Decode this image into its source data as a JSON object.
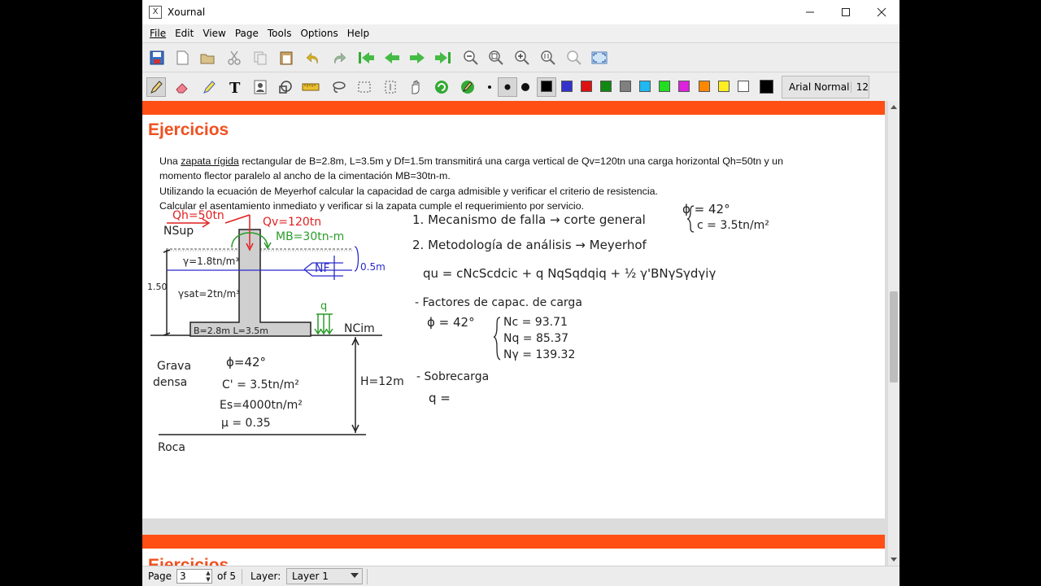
{
  "window": {
    "title": "Xournal",
    "app_icon_glyph": "X"
  },
  "menu": [
    "File",
    "Edit",
    "View",
    "Page",
    "Tools",
    "Options",
    "Help"
  ],
  "toolbar1": [
    "save-icon",
    "new-page-icon",
    "open-icon",
    "cut-icon",
    "copy-icon",
    "paste-icon",
    "undo-icon",
    "redo-icon",
    "first-page-icon",
    "previous-page-icon",
    "next-page-icon",
    "last-page-icon",
    "zoom-out-icon",
    "zoom-fit-icon",
    "zoom-in-icon",
    "zoom-100-icon",
    "zoom-width-icon",
    "fullscreen-icon"
  ],
  "toolbar2": {
    "tools": [
      "pen-icon",
      "eraser-icon",
      "highlighter-icon",
      "text-icon",
      "image-icon",
      "shape-recognizer-icon",
      "ruler-icon",
      "lasso-select-icon",
      "rect-select-icon",
      "vertical-space-icon",
      "hand-icon",
      "default-tool-icon",
      "default-pen-icon"
    ],
    "active_tool": "pen-icon",
    "thickness": [
      "fine",
      "medium",
      "thick"
    ],
    "active_thickness": "medium",
    "colors": [
      "#000000",
      "#3333cc",
      "#dd1111",
      "#118811",
      "#808080",
      "#1fb8f0",
      "#22dd22",
      "#dd22dd",
      "#ff8800",
      "#ffee22",
      "#ffffff",
      "#000000"
    ],
    "active_color_index": 0,
    "font_name": "Arial Normal",
    "font_size": "12"
  },
  "page_content": {
    "title": "Ejercicios",
    "paragraph": {
      "p1": "Una",
      "p1_underlined": "zapata rígida",
      "p1_rest": "rectangular de B=2.8m, L=3.5m y Df=1.5m transmitirá una carga vertical de Qv=120tn una carga horizontal Qh=50tn y un",
      "p2": "momento flector paralelo al ancho de la cimentación MB=30tn-m.",
      "p3": "Utilizando la ecuación de Meyerhof calcular la capacidad de carga admisible y verificar el criterio de resistencia.",
      "p4": "Calcular el asentamiento inmediato y verificar si la zapata cumple el requerimiento por servicio."
    },
    "next_page_title": "Ejercicios"
  },
  "handwriting": {
    "qh": "Qh=50tn",
    "qv": "Qv=120tn",
    "mb": "MB=30tn-m",
    "nsup": "NSup",
    "gamma": "γ=1.8tn/m³",
    "gamma_sat": "γsat=2tn/m³",
    "depth": "1.50",
    "nf": "NF",
    "nf_depth": "0.5m",
    "q": "q",
    "ncim": "NCim",
    "b_l": "B=2.8m  L=3.5m",
    "grava": "Grava",
    "densa": "densa",
    "phi": "ϕ=42°",
    "c": "C' = 3.5tn/m²",
    "es": "Es=4000tn/m²",
    "mu": "μ = 0.35",
    "h": "H=12m",
    "roca": "Roca",
    "item1": "1. Mecanismo de falla → corte general",
    "phi_c_1": "ϕ = 42°",
    "phi_c_2": "c = 3.5tn/m²",
    "item2": "2. Metodología de análisis → Meyerhof",
    "formula": "qu = cNcScdcic + q NqSqdqiq + ½ γ'BNγSγdγiγ",
    "factores": "- Factores de capac. de carga",
    "phi2": "ϕ = 42°",
    "nc": "Nc = 93.71",
    "nq": "Nq = 85.37",
    "ng": "Nγ = 139.32",
    "sobrecarga": "- Sobrecarga",
    "q_eq": "q ="
  },
  "status": {
    "page_label": "Page",
    "page_value": "3",
    "of_label": "of 5",
    "layer_label": "Layer:",
    "layer_value": "Layer 1"
  }
}
